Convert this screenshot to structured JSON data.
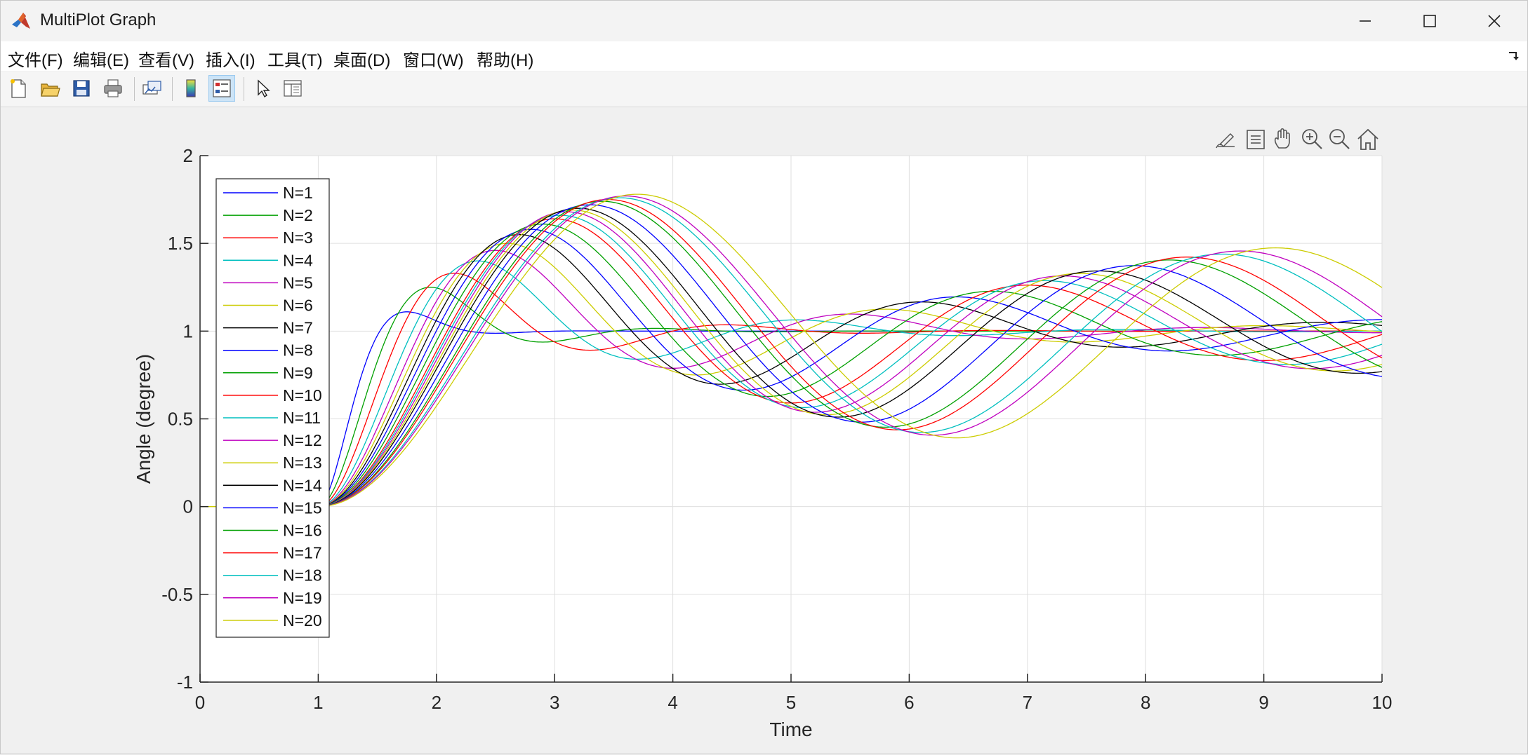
{
  "window": {
    "title": "MultiPlot Graph",
    "controls": {
      "minimize": "minimize-icon",
      "maximize": "maximize-icon",
      "close": "close-icon"
    }
  },
  "menu": [
    {
      "label": "文件(F)"
    },
    {
      "label": "编辑(E)"
    },
    {
      "label": "查看(V)"
    },
    {
      "label": "插入(I)"
    },
    {
      "label": "工具(T)"
    },
    {
      "label": "桌面(D)"
    },
    {
      "label": "窗口(W)"
    },
    {
      "label": "帮助(H)"
    }
  ],
  "toolbar": {
    "buttons": [
      "new-figure-icon",
      "open-file-icon",
      "save-icon",
      "print-icon",
      "link-plot-icon",
      "colorbar-icon",
      "legend-icon",
      "edit-plot-icon",
      "property-inspector-icon"
    ],
    "active": "legend-icon"
  },
  "axes_toolbar": [
    "brush-icon",
    "data-tips-icon",
    "pan-icon",
    "zoom-in-icon",
    "zoom-out-icon",
    "home-icon"
  ],
  "chart_data": {
    "type": "line",
    "title": "",
    "xlabel": "Time",
    "ylabel": "Angle (degree)",
    "xlim": [
      0,
      10
    ],
    "ylim": [
      -1,
      2
    ],
    "xticks": [
      "0",
      "1",
      "2",
      "3",
      "4",
      "5",
      "6",
      "7",
      "8",
      "9",
      "10"
    ],
    "yticks": [
      "-1",
      "-0.5",
      "0",
      "0.5",
      "1",
      "1.5",
      "2"
    ],
    "grid": true,
    "legend_position": "top-left",
    "colors": [
      "#0000ff",
      "#00a000",
      "#ff0000",
      "#00bfbf",
      "#bf00bf",
      "#cccc00",
      "#000000"
    ],
    "line_model": "step response starting at t=1: y = 1 - exp(-z*w*t') * (cos(wd*t') + z/sqrt(1-z^2)*sin(wd*t')); N from 1 to 20",
    "series": [
      {
        "name": "N=1",
        "peak_time": 1.75,
        "peak": 1.11
      },
      {
        "name": "N=2",
        "peak_time": 1.95,
        "peak": 1.25
      },
      {
        "name": "N=3",
        "peak_time": 2.15,
        "peak": 1.33
      },
      {
        "name": "N=4",
        "peak_time": 2.35,
        "peak": 1.4
      },
      {
        "name": "N=5",
        "peak_time": 2.5,
        "peak": 1.46
      },
      {
        "name": "N=6",
        "peak_time": 2.6,
        "peak": 1.5
      },
      {
        "name": "N=7",
        "peak_time": 2.7,
        "peak": 1.55
      },
      {
        "name": "N=8",
        "peak_time": 2.8,
        "peak": 1.58
      },
      {
        "name": "N=9",
        "peak_time": 2.9,
        "peak": 1.61
      },
      {
        "name": "N=10",
        "peak_time": 3.0,
        "peak": 1.64
      },
      {
        "name": "N=11",
        "peak_time": 3.05,
        "peak": 1.66
      },
      {
        "name": "N=12",
        "peak_time": 3.1,
        "peak": 1.68
      },
      {
        "name": "N=13",
        "peak_time": 3.15,
        "peak": 1.69
      },
      {
        "name": "N=14",
        "peak_time": 3.2,
        "peak": 1.7
      },
      {
        "name": "N=15",
        "peak_time": 3.3,
        "peak": 1.72
      },
      {
        "name": "N=16",
        "peak_time": 3.4,
        "peak": 1.74
      },
      {
        "name": "N=17",
        "peak_time": 3.45,
        "peak": 1.75
      },
      {
        "name": "N=18",
        "peak_time": 3.55,
        "peak": 1.76
      },
      {
        "name": "N=19",
        "peak_time": 3.6,
        "peak": 1.77
      },
      {
        "name": "N=20",
        "peak_time": 3.7,
        "peak": 1.78
      }
    ]
  }
}
